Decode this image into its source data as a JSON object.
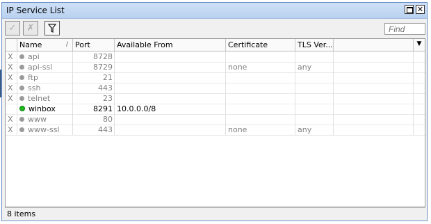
{
  "window": {
    "title": "IP Service List"
  },
  "titlebar_buttons": {
    "maximize_icon": "maximize-icon",
    "close_label": "✕"
  },
  "toolbar": {
    "enable_icon": "✓",
    "disable_icon": "✗",
    "filter_icon": "filter-icon",
    "find_placeholder": "Find"
  },
  "table": {
    "columns": [
      "Name",
      "Port",
      "Available From",
      "Certificate",
      "TLS Ver..."
    ],
    "rows": [
      {
        "flag": "X",
        "name": "api",
        "port": "8728",
        "available_from": "",
        "certificate": "",
        "tls": "",
        "disabled": true
      },
      {
        "flag": "X",
        "name": "api-ssl",
        "port": "8729",
        "available_from": "",
        "certificate": "none",
        "tls": "any",
        "disabled": true
      },
      {
        "flag": "X",
        "name": "ftp",
        "port": "21",
        "available_from": "",
        "certificate": "",
        "tls": "",
        "disabled": true
      },
      {
        "flag": "X",
        "name": "ssh",
        "port": "443",
        "available_from": "",
        "certificate": "",
        "tls": "",
        "disabled": true
      },
      {
        "flag": "X",
        "name": "telnet",
        "port": "23",
        "available_from": "",
        "certificate": "",
        "tls": "",
        "disabled": true
      },
      {
        "flag": "",
        "name": "winbox",
        "port": "8291",
        "available_from": "10.0.0.0/8",
        "certificate": "",
        "tls": "",
        "disabled": false
      },
      {
        "flag": "X",
        "name": "www",
        "port": "80",
        "available_from": "",
        "certificate": "",
        "tls": "",
        "disabled": true
      },
      {
        "flag": "X",
        "name": "www-ssl",
        "port": "443",
        "available_from": "",
        "certificate": "none",
        "tls": "any",
        "disabled": true
      }
    ]
  },
  "status": {
    "count": "8 items"
  },
  "colors": {
    "titlebar": "#b9d1f0",
    "enabled_dot": "#1fb81f",
    "disabled_text": "#808080"
  }
}
